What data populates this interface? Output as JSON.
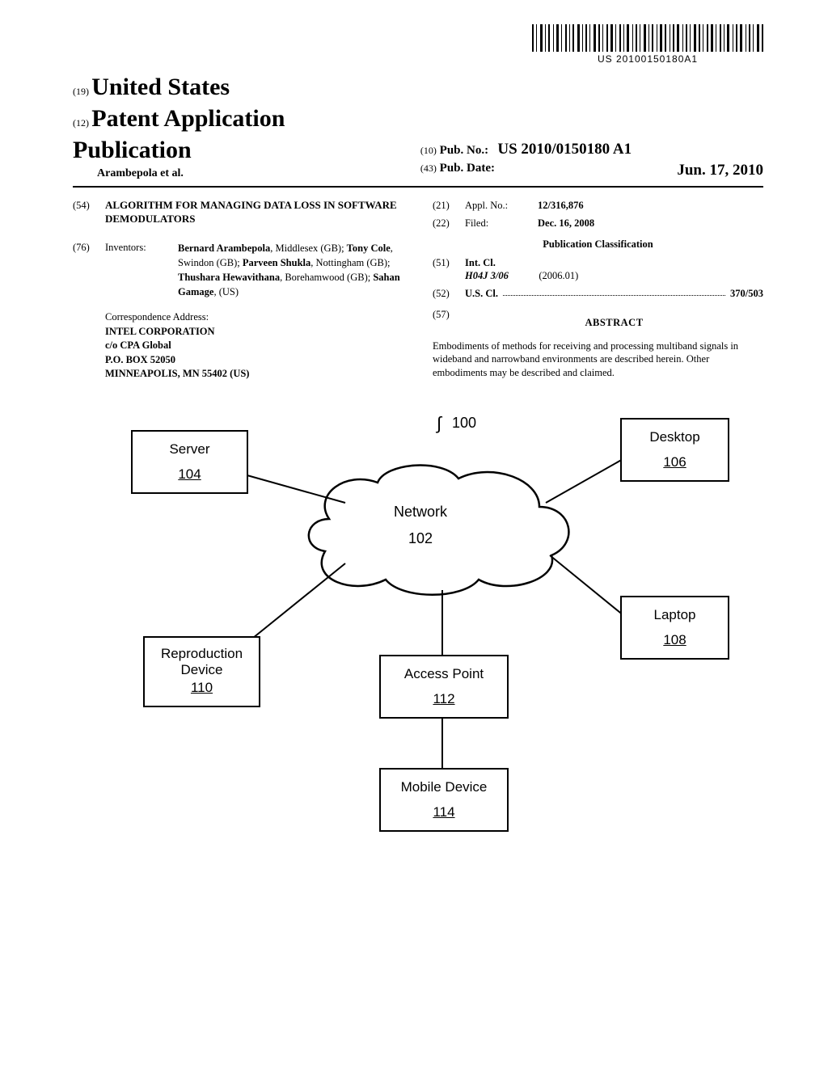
{
  "barcode_text": "US 20100150180A1",
  "hl": {
    "code19": "(19)",
    "country": "United States",
    "code12": "(12)",
    "doctype": "Patent Application Publication",
    "authors_line": "Arambepola et al.",
    "code10": "(10)",
    "pubno_lbl": "Pub. No.:",
    "pubno_val": "US 2010/0150180 A1",
    "code43": "(43)",
    "pubdate_lbl": "Pub. Date:",
    "pubdate_val": "Jun. 17, 2010"
  },
  "left": {
    "code54": "(54)",
    "title": "ALGORITHM FOR MANAGING DATA LOSS IN SOFTWARE DEMODULATORS",
    "code76": "(76)",
    "inventors_lbl": "Inventors:",
    "inventors_html": "Bernard Arambepola|, Middlesex (GB); |Tony Cole|, Swindon (GB); |Parveen Shukla|, Nottingham (GB); |Thushara Hewavithana|, Borehamwood (GB); |Sahan Gamage|, (US)",
    "corr_lbl": "Correspondence Address:",
    "corr": [
      "INTEL CORPORATION",
      "c/o CPA Global",
      "P.O. BOX 52050",
      "MINNEAPOLIS, MN 55402 (US)"
    ]
  },
  "right": {
    "code21": "(21)",
    "applno_lbl": "Appl. No.:",
    "applno": "12/316,876",
    "code22": "(22)",
    "filed_lbl": "Filed:",
    "filed": "Dec. 16, 2008",
    "pubclass": "Publication Classification",
    "code51": "(51)",
    "intcl_lbl": "Int. Cl.",
    "intcl_sym": "H04J 3/06",
    "intcl_date": "(2006.01)",
    "code52": "(52)",
    "uscl_lbl": "U.S. Cl.",
    "uscl_val": "370/503",
    "code57": "(57)",
    "abstract_lbl": "ABSTRACT",
    "abstract": "Embodiments of methods for receiving and processing multiband signals in wideband and narrowband environments are described herein. Other embodiments may be described and claimed."
  },
  "diagram": {
    "ref100": "100",
    "server": {
      "label": "Server",
      "ref": "104"
    },
    "desktop": {
      "label": "Desktop",
      "ref": "106"
    },
    "network": {
      "label": "Network",
      "ref": "102"
    },
    "laptop": {
      "label": "Laptop",
      "ref": "108"
    },
    "repro": {
      "label": "Reproduction Device",
      "ref": "110"
    },
    "ap": {
      "label": "Access Point",
      "ref": "112"
    },
    "mobile": {
      "label": "Mobile Device",
      "ref": "114"
    }
  }
}
